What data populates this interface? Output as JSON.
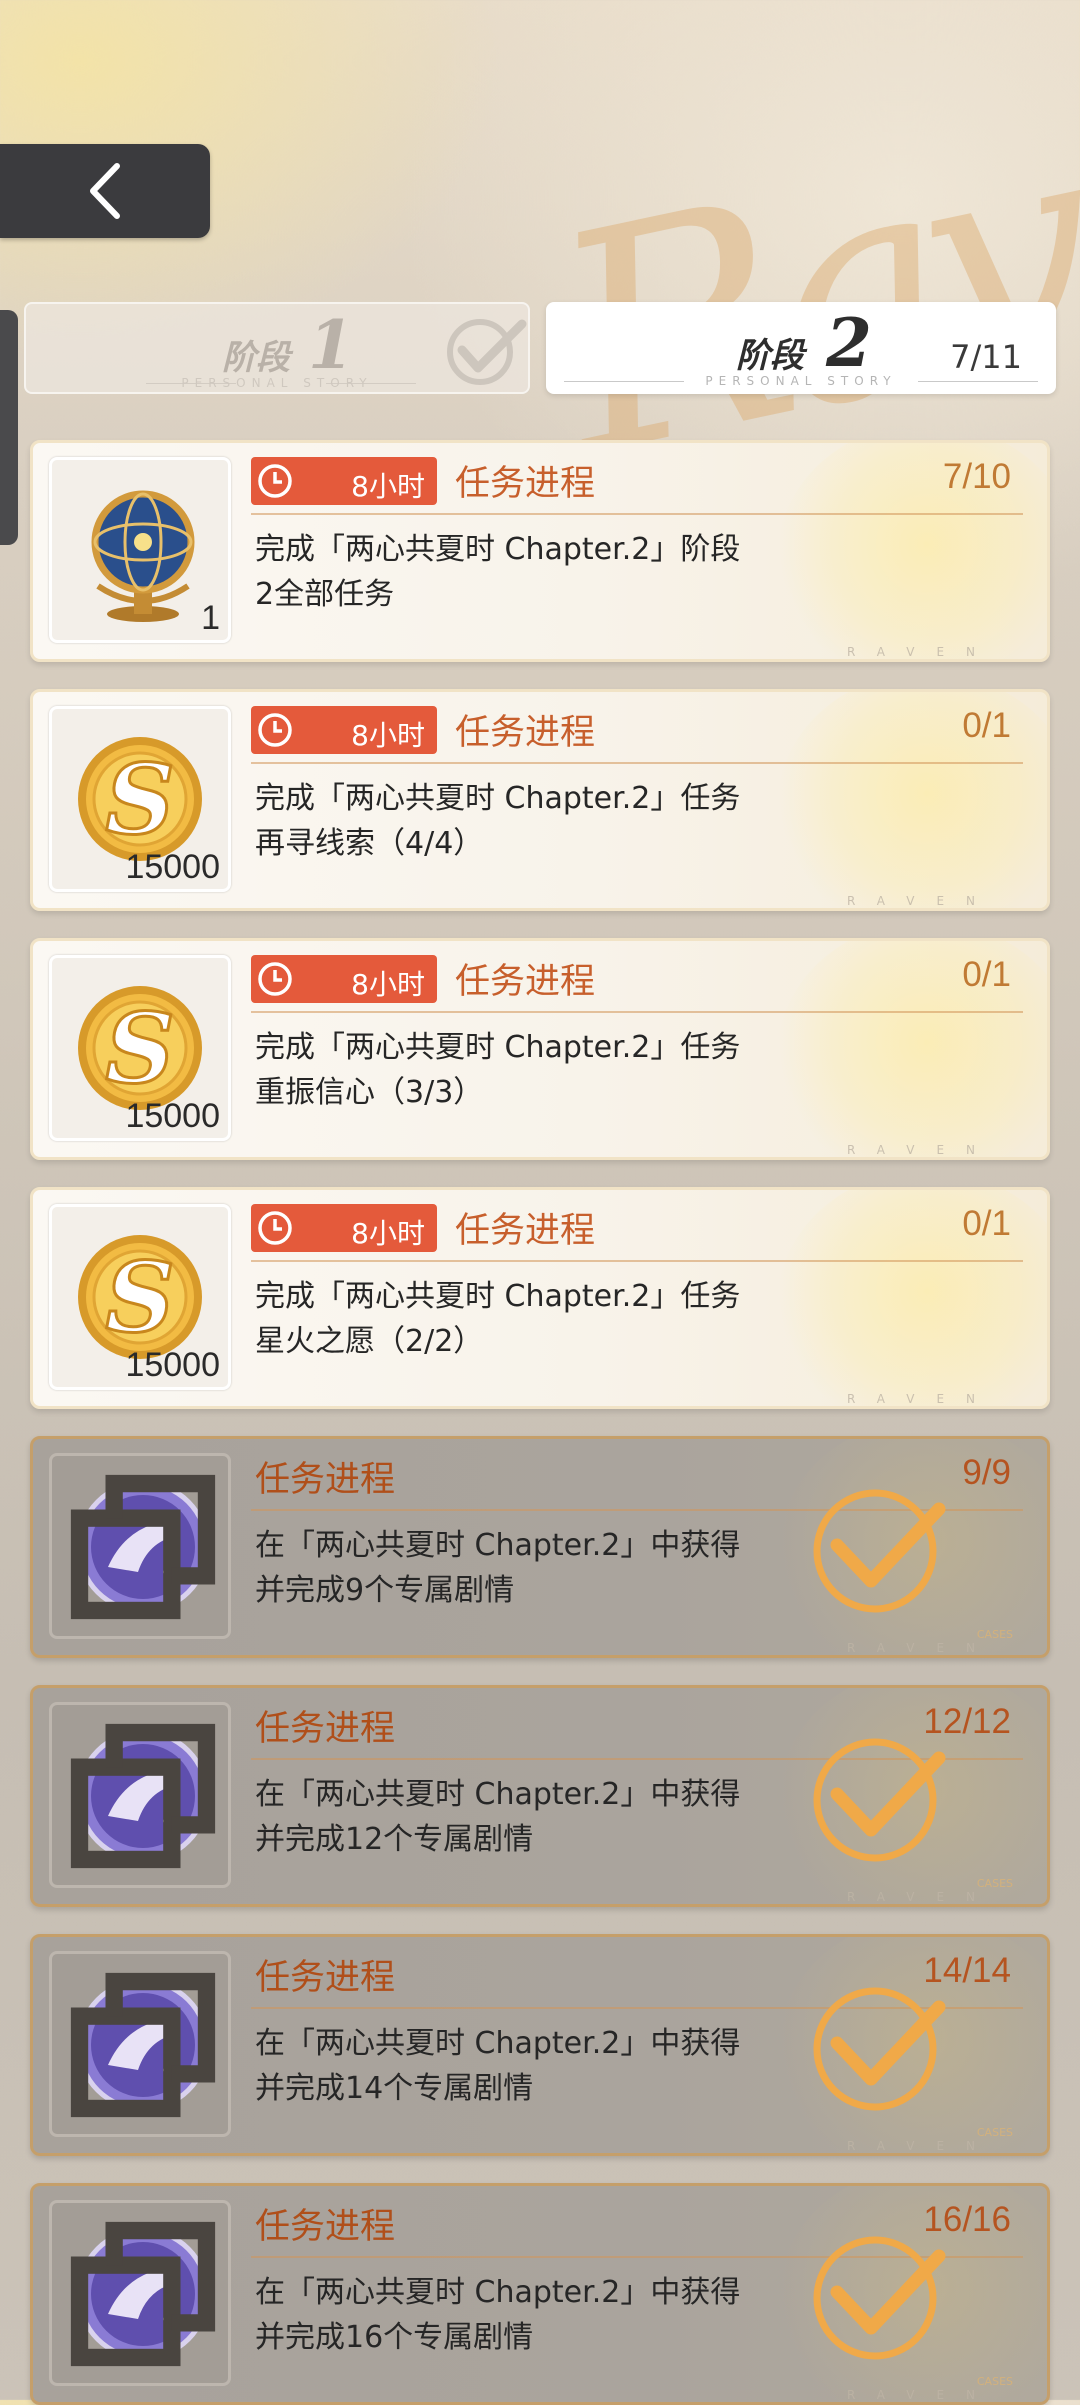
{
  "background_script": "Raven",
  "tabs": [
    {
      "label": "阶段",
      "number": "1",
      "subtitle": "PERSONAL STORY",
      "state": "completed"
    },
    {
      "label": "阶段",
      "number": "2",
      "subtitle": "PERSONAL STORY",
      "progress": "7/11",
      "state": "selected"
    }
  ],
  "tasks": [
    {
      "icon": "globe-icon",
      "count": "1",
      "timer": "8小时",
      "title": "任务进程",
      "progress": "7/10",
      "desc_line1": "完成「两心共夏时 Chapter.2」阶段",
      "desc_line2": "2全部任务",
      "footer": "RAVEN"
    },
    {
      "icon": "gold-coin-icon",
      "count": "15000",
      "timer": "8小时",
      "title": "任务进程",
      "progress": "0/1",
      "desc_line1": "完成「两心共夏时 Chapter.2」任务",
      "desc_line2": "再寻线索（4/4）",
      "footer": "RAVEN"
    },
    {
      "icon": "gold-coin-icon",
      "count": "15000",
      "timer": "8小时",
      "title": "任务进程",
      "progress": "0/1",
      "desc_line1": "完成「两心共夏时 Chapter.2」任务",
      "desc_line2": "重振信心（3/3）",
      "footer": "RAVEN"
    },
    {
      "icon": "gold-coin-icon",
      "count": "15000",
      "timer": "8小时",
      "title": "任务进程",
      "progress": "0/1",
      "desc_line1": "完成「两心共夏时 Chapter.2」任务",
      "desc_line2": "星火之愿（2/2）",
      "footer": "RAVEN"
    },
    {
      "icon": "purple-badge-icon",
      "title": "任务进程",
      "progress": "9/9",
      "desc_line1": "在「两心共夏时 Chapter.2」中获得",
      "desc_line2": "并完成9个专属剧情",
      "footer": "RAVEN",
      "corner": "CASES"
    },
    {
      "icon": "purple-badge-icon",
      "title": "任务进程",
      "progress": "12/12",
      "desc_line1": "在「两心共夏时 Chapter.2」中获得",
      "desc_line2": "并完成12个专属剧情",
      "footer": "RAVEN",
      "corner": "CASES"
    },
    {
      "icon": "purple-badge-icon",
      "title": "任务进程",
      "progress": "14/14",
      "desc_line1": "在「两心共夏时 Chapter.2」中获得",
      "desc_line2": "并完成14个专属剧情",
      "footer": "RAVEN",
      "corner": "CASES"
    },
    {
      "icon": "purple-badge-icon",
      "title": "任务进程",
      "progress": "16/16",
      "desc_line1": "在「两心共夏时 Chapter.2」中获得",
      "desc_line2": "并完成16个专属剧情",
      "footer": "RAVEN",
      "corner": "CASES"
    }
  ],
  "colors": {
    "accent_orange": "#e45a3b",
    "title_orange": "#c75f2c",
    "check_gold": "#f0a948"
  }
}
